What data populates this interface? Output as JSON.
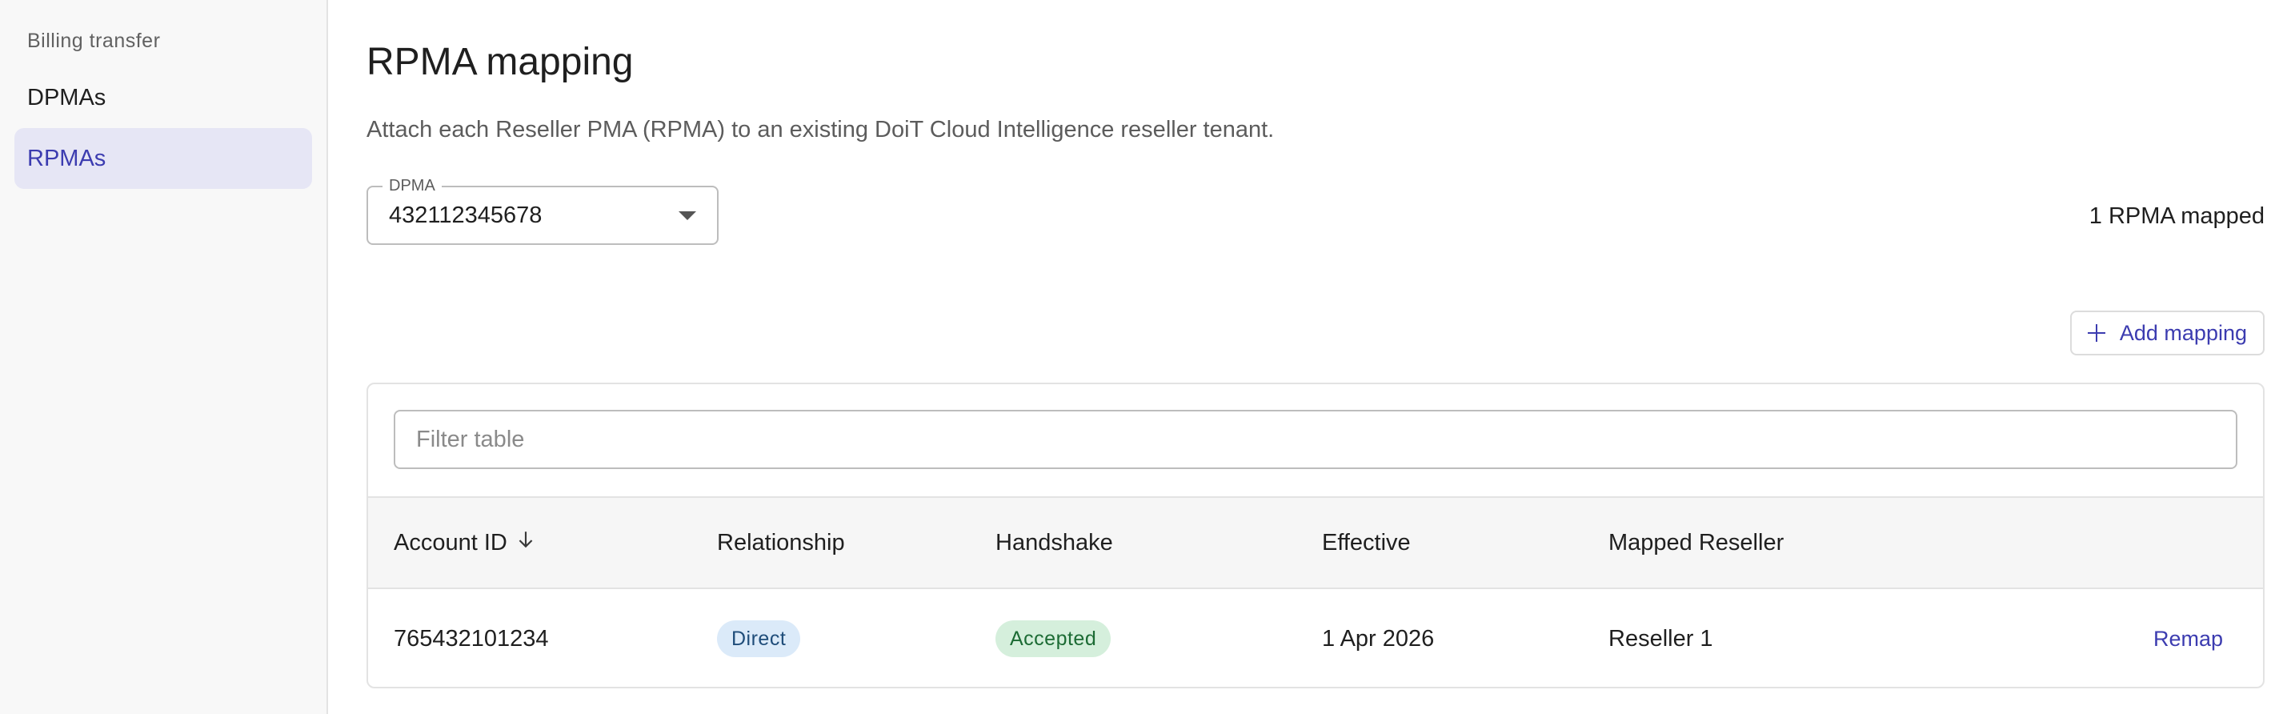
{
  "sidebar": {
    "section_label": "Billing transfer",
    "items": [
      {
        "label": "DPMAs",
        "active": false
      },
      {
        "label": "RPMAs",
        "active": true
      }
    ]
  },
  "page": {
    "title": "RPMA mapping",
    "description": "Attach each Reseller PMA (RPMA) to an existing DoiT Cloud Intelligence reseller tenant."
  },
  "dpma_select": {
    "label": "DPMA",
    "value": "432112345678"
  },
  "mapped_count": "1 RPMA mapped",
  "add_button": {
    "label": "Add mapping",
    "icon": "plus-icon"
  },
  "table": {
    "filter_placeholder": "Filter table",
    "columns": {
      "account_id": "Account ID",
      "relationship": "Relationship",
      "handshake": "Handshake",
      "effective": "Effective",
      "mapped_reseller": "Mapped Reseller"
    },
    "sort_icon": "arrow-down-icon",
    "rows": [
      {
        "account_id": "765432101234",
        "relationship": "Direct",
        "handshake": "Accepted",
        "effective": "1 Apr 2026",
        "mapped_reseller": "Reseller 1",
        "action": "Remap"
      }
    ]
  },
  "colors": {
    "accent": "#3c3cb0",
    "active_nav_bg": "#e6e6f5",
    "chip_direct_bg": "#dbeaf9",
    "chip_accepted_bg": "#d5efdc"
  }
}
